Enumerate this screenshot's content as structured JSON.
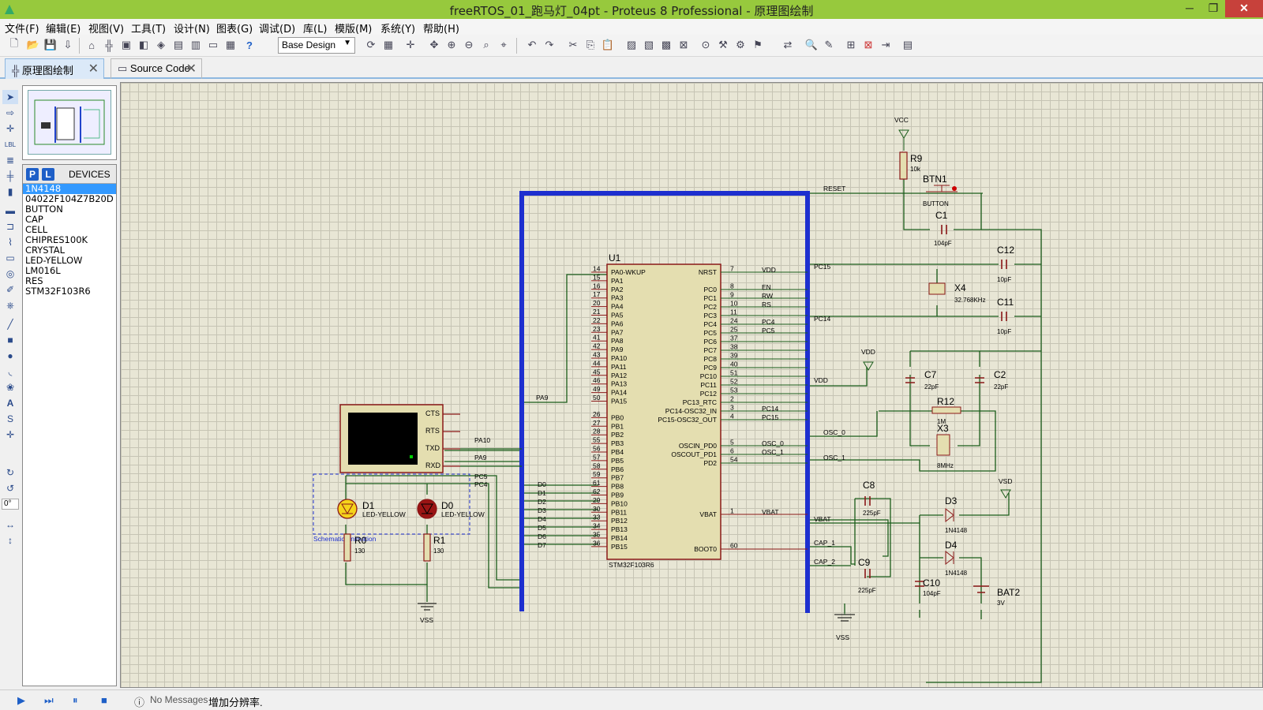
{
  "window": {
    "title": "freeRTOS_01_跑马灯_04pt - Proteus 8 Professional - 原理图绘制",
    "minimize": "─",
    "maximize": "❐",
    "close": "✕"
  },
  "menu": [
    "文件(F)",
    "编辑(E)",
    "视图(V)",
    "工具(T)",
    "设计(N)",
    "图表(G)",
    "调试(D)",
    "库(L)",
    "模版(M)",
    "系统(Y)",
    "帮助(H)"
  ],
  "toolbar": {
    "design_select": "Base Design"
  },
  "tabs": [
    {
      "label": "原理图绘制",
      "active": true
    },
    {
      "label": "Source Code",
      "active": false
    }
  ],
  "devices": {
    "p_btn": "P",
    "l_btn": "L",
    "header": "DEVICES",
    "items": [
      "1N4148",
      "04022F104Z7B20D",
      "BUTTON",
      "CAP",
      "CELL",
      "CHIPRES100K",
      "CRYSTAL",
      "LED-YELLOW",
      "LM016L",
      "RES",
      "STM32F103R6"
    ],
    "selected": "1N4148"
  },
  "rotation": "0°",
  "status": {
    "messages": "No Messages",
    "hint": "增加分辨率."
  },
  "schematic": {
    "u1": {
      "ref": "U1",
      "part": "STM32F103R6",
      "left_pins": [
        [
          "14",
          "PA0-WKUP"
        ],
        [
          "15",
          "PA1"
        ],
        [
          "16",
          "PA2"
        ],
        [
          "17",
          "PA3"
        ],
        [
          "20",
          "PA4"
        ],
        [
          "21",
          "PA5"
        ],
        [
          "22",
          "PA6"
        ],
        [
          "23",
          "PA7"
        ],
        [
          "41",
          "PA8"
        ],
        [
          "42",
          "PA9"
        ],
        [
          "43",
          "PA10"
        ],
        [
          "44",
          "PA11"
        ],
        [
          "45",
          "PA12"
        ],
        [
          "46",
          "PA13"
        ],
        [
          "49",
          "PA14"
        ],
        [
          "50",
          "PA15"
        ],
        [
          "26",
          "PB0"
        ],
        [
          "27",
          "PB1"
        ],
        [
          "28",
          "PB2"
        ],
        [
          "55",
          "PB3"
        ],
        [
          "56",
          "PB4"
        ],
        [
          "57",
          "PB5"
        ],
        [
          "58",
          "PB6"
        ],
        [
          "59",
          "PB7"
        ],
        [
          "61",
          "PB8"
        ],
        [
          "62",
          "PB9"
        ],
        [
          "29",
          "PB10"
        ],
        [
          "30",
          "PB11"
        ],
        [
          "33",
          "PB12"
        ],
        [
          "34",
          "PB13"
        ],
        [
          "35",
          "PB14"
        ],
        [
          "36",
          "PB15"
        ]
      ],
      "right_pins": [
        [
          "7",
          "NRST"
        ],
        [
          "8",
          "PC0"
        ],
        [
          "9",
          "PC1"
        ],
        [
          "10",
          "PC2"
        ],
        [
          "11",
          "PC3"
        ],
        [
          "24",
          "PC4"
        ],
        [
          "25",
          "PC5"
        ],
        [
          "37",
          "PC6"
        ],
        [
          "38",
          "PC7"
        ],
        [
          "39",
          "PC8"
        ],
        [
          "40",
          "PC9"
        ],
        [
          "51",
          "PC10"
        ],
        [
          "52",
          "PC11"
        ],
        [
          "53",
          "PC12"
        ],
        [
          "2",
          "PC13_RTC"
        ],
        [
          "3",
          "PC14-OSC32_IN"
        ],
        [
          "4",
          "PC15-OSC32_OUT"
        ],
        [
          "5",
          "OSCIN_PD0"
        ],
        [
          "6",
          "OSCOUT_PD1"
        ],
        [
          "54",
          "PD2"
        ],
        [
          "1",
          "VBAT"
        ],
        [
          "60",
          "BOOT0"
        ]
      ]
    },
    "labels": {
      "vcc": "VCC",
      "vdd": "VDD",
      "vss": "VSS",
      "vsd": "VSD",
      "reset": "RESET",
      "pc15": "PC15",
      "pc14": "PC14",
      "vdd_net": "VDD",
      "osc0": "OSC_0",
      "osc1": "OSC_1",
      "vbat": "VBAT",
      "cap1": "CAP_1",
      "cap2": "CAP_2",
      "pa9": "PA9",
      "pa10": "PA10",
      "pc5": "PC5",
      "pc4": "PC4",
      "d0": "D0",
      "d1": "D1",
      "d2": "D2",
      "d3": "D3",
      "d4": "D4",
      "d5": "D5",
      "d6": "D6",
      "d7": "D7",
      "en": "EN",
      "rw": "RW",
      "rs": "RS",
      "vdd_r": "VDD",
      "pc4_r": "PC4",
      "pc5_r": "PC5",
      "pc14_r": "PC14",
      "pc15_r": "PC15",
      "osc0_r": "OSC_0",
      "osc1_r": "OSC_1",
      "vbat_r": "VBAT"
    },
    "components": {
      "r9": [
        "R9",
        "10k"
      ],
      "btn1": [
        "BTN1",
        "BUTTON"
      ],
      "c1": [
        "C1",
        "104pF"
      ],
      "c12": [
        "C12",
        "10pF"
      ],
      "x4": [
        "X4",
        "32.768KHz"
      ],
      "c11": [
        "C11",
        "10pF"
      ],
      "c7": [
        "C7",
        "22pF"
      ],
      "c2": [
        "C2",
        "22pF"
      ],
      "r12": [
        "R12",
        "1M"
      ],
      "x3": [
        "X3",
        "8MHz"
      ],
      "c8": [
        "C8",
        "225pF"
      ],
      "c9": [
        "C9",
        "225pF"
      ],
      "c10": [
        "C10",
        "104pF"
      ],
      "d3": [
        "D3",
        "1N4148"
      ],
      "d4": [
        "D4",
        "1N4148"
      ],
      "bat2": [
        "BAT2",
        "3V"
      ],
      "d1": [
        "D1",
        "LED-YELLOW"
      ],
      "d0": [
        "D0",
        "LED-YELLOW"
      ],
      "r0": [
        "R0",
        "130"
      ],
      "r1": [
        "R1",
        "130"
      ]
    },
    "terminal_pins": [
      "CTS",
      "RTS",
      "TXD",
      "RXD"
    ],
    "annotation": "Schematic Animation"
  }
}
